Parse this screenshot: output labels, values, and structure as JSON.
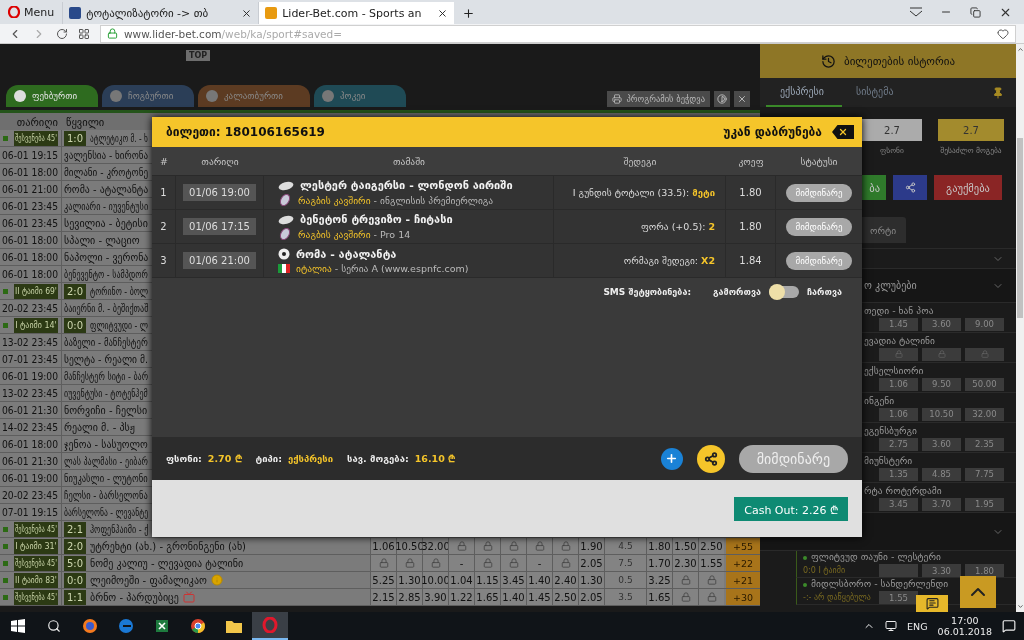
{
  "browser": {
    "menu_label": "Menu",
    "tabs": [
      {
        "title": "ტოტალიზატორი -> თბ",
        "selected": false
      },
      {
        "title": "Lider-Bet.com - Sports an",
        "selected": true
      }
    ],
    "url_host": "www.lider-bet.com",
    "url_path": "/web/ka/sport#saved="
  },
  "top_strip": {
    "badge": "TOP"
  },
  "sport_tabs": [
    {
      "label": "ფეხბურთი",
      "selected": true,
      "color": "#2e6b1f"
    },
    {
      "label": "ჩოგბურთი",
      "selected": false,
      "color": "#2b3e57"
    },
    {
      "label": "კალათბურთი",
      "selected": false,
      "color": "#5c3b22"
    },
    {
      "label": "ჰოკეი",
      "selected": false,
      "color": "#1f4a55"
    }
  ],
  "print_button": "პროგრამის ბეჭდვა",
  "events_table": {
    "columns": [
      "თარიღი",
      "წყვილი"
    ],
    "rows": [
      {
        "kind": "live",
        "status": "შესვენება 45'",
        "score": "1:0",
        "match": "ატლეტიკო მ. - ხ"
      },
      {
        "kind": "scheduled",
        "date": "06-01 19:15",
        "match": "ვალენსია - ხირონა"
      },
      {
        "kind": "scheduled",
        "date": "06-01 18:00",
        "match": "მილანი - კროტონე"
      },
      {
        "kind": "scheduled",
        "date": "06-01 21:00",
        "match": "რომა - ატალანტა"
      },
      {
        "kind": "scheduled",
        "date": "06-01 23:45",
        "match": "კალიარი - იუვენტუსი"
      },
      {
        "kind": "scheduled",
        "date": "06-01 23:45",
        "match": "სევილია - ბეტისი"
      },
      {
        "kind": "scheduled",
        "date": "06-01 18:00",
        "match": "სპალი - ლაციო"
      },
      {
        "kind": "scheduled",
        "date": "06-01 18:00",
        "match": "ნაპოლი - ვერონა"
      },
      {
        "kind": "scheduled",
        "date": "06-01 18:00",
        "match": "ბენევენტო - სამპდორ"
      },
      {
        "kind": "live",
        "status": "II ტაიმი 69'",
        "score": "2:0",
        "match": "ტორინო - ბოლ"
      },
      {
        "kind": "scheduled",
        "date": "20-02 23:45",
        "match": "ბაიერნი მ. - ბეშიქთაშ"
      },
      {
        "kind": "live",
        "status": "I ტაიმი 14'",
        "score": "0:0",
        "match": "ფლიტვუდი - ლ"
      },
      {
        "kind": "scheduled",
        "date": "13-02 23:45",
        "match": "ბაზელი - მანჩესტერ"
      },
      {
        "kind": "scheduled",
        "date": "07-01 23:45",
        "match": "სელტა - რეალი მ."
      },
      {
        "kind": "scheduled",
        "date": "06-01 19:00",
        "match": "მანჩესტერ სიტი - ბარ"
      },
      {
        "kind": "scheduled",
        "date": "13-02 23:45",
        "match": "იუვენტუსი - ტოტენჰემ"
      },
      {
        "kind": "scheduled",
        "date": "06-01 21:30",
        "match": "ნორვიჩი - ჩელსი"
      },
      {
        "kind": "scheduled",
        "date": "14-02 23:45",
        "match": "რეალი მ. - პსჟ"
      },
      {
        "kind": "scheduled",
        "date": "06-01 18:00",
        "match": "ჯენოა - სასუოლო"
      },
      {
        "kind": "scheduled",
        "date": "06-01 21:30",
        "match": "ლას პალმასი - ეიბარ"
      },
      {
        "kind": "scheduled",
        "date": "06-01 19:00",
        "match": "ნიუკასლი - ლუტონი"
      },
      {
        "kind": "scheduled",
        "date": "20-02 23:45",
        "match": "ჩელსი - ბარსელონა"
      },
      {
        "kind": "scheduled",
        "date": "07-01 19:15",
        "match": "ბარსელონა - ლევანტე"
      },
      {
        "kind": "live",
        "status": "შესვენება 45'",
        "score": "2:1",
        "match": "ჰოფენჰაიმი - ქ"
      },
      {
        "kind": "live",
        "status": "I ტაიმი 31'",
        "score": "2:0",
        "match": "უტრეხტი (ახ.) - გრონინგენი (ახ)",
        "more": "+55",
        "odds": [
          {
            "kind": "odd",
            "value": "1.06"
          },
          {
            "kind": "odd",
            "value": "10.50"
          },
          {
            "kind": "odd",
            "value": "32.00"
          },
          {
            "kind": "locked"
          },
          {
            "kind": "locked"
          },
          {
            "kind": "locked"
          },
          {
            "kind": "locked"
          },
          {
            "kind": "locked"
          },
          {
            "kind": "odd",
            "value": "1.90"
          },
          {
            "kind": "line",
            "value": "4.5"
          },
          {
            "kind": "odd",
            "value": "1.80"
          },
          {
            "kind": "odd",
            "value": "1.50"
          },
          {
            "kind": "odd",
            "value": "2.50"
          }
        ]
      },
      {
        "kind": "live",
        "status": "შესვენება 45'",
        "score": "5:0",
        "match": "ნომე კალიუ - ლევადია ტალინი",
        "more": "+22",
        "odds": [
          {
            "kind": "locked"
          },
          {
            "kind": "locked"
          },
          {
            "kind": "locked"
          },
          {
            "kind": "odd",
            "value": "-"
          },
          {
            "kind": "locked"
          },
          {
            "kind": "locked"
          },
          {
            "kind": "odd",
            "value": "-"
          },
          {
            "kind": "locked"
          },
          {
            "kind": "odd",
            "value": "2.05"
          },
          {
            "kind": "line",
            "value": "7.5"
          },
          {
            "kind": "odd",
            "value": "1.70"
          },
          {
            "kind": "odd",
            "value": "2.30"
          },
          {
            "kind": "odd",
            "value": "1.55"
          }
        ]
      },
      {
        "kind": "live",
        "status": "II ტაიმი 83'",
        "score": "0:0",
        "match": "ლეიმოეში - ფამალიკაო",
        "marker": {
          "kind": "info"
        },
        "more": "+21",
        "odds": [
          {
            "kind": "odd",
            "value": "5.25"
          },
          {
            "kind": "odd",
            "value": "1.30"
          },
          {
            "kind": "odd",
            "value": "10.00"
          },
          {
            "kind": "odd",
            "value": "1.04"
          },
          {
            "kind": "odd",
            "value": "1.15"
          },
          {
            "kind": "odd",
            "value": "3.45"
          },
          {
            "kind": "odd",
            "value": "1.40"
          },
          {
            "kind": "odd",
            "value": "2.40"
          },
          {
            "kind": "odd",
            "value": "1.30"
          },
          {
            "kind": "line",
            "value": "0.5"
          },
          {
            "kind": "odd",
            "value": "3.25"
          },
          {
            "kind": "locked"
          },
          {
            "kind": "locked"
          }
        ]
      },
      {
        "kind": "live",
        "status": "შესვენება 45'",
        "score": "1:1",
        "match": "ბრნო - პარდუბიცე",
        "marker": {
          "kind": "tv"
        },
        "more": "+30",
        "odds": [
          {
            "kind": "odd",
            "value": "2.15"
          },
          {
            "kind": "odd",
            "value": "2.85"
          },
          {
            "kind": "odd",
            "value": "3.90"
          },
          {
            "kind": "odd",
            "value": "1.22"
          },
          {
            "kind": "odd",
            "value": "1.65"
          },
          {
            "kind": "odd",
            "value": "1.40"
          },
          {
            "kind": "odd",
            "value": "1.45"
          },
          {
            "kind": "odd",
            "value": "2.50"
          },
          {
            "kind": "odd",
            "value": "2.05"
          },
          {
            "kind": "line",
            "value": "3.5"
          },
          {
            "kind": "odd",
            "value": "1.65"
          },
          {
            "kind": "locked"
          },
          {
            "kind": "locked"
          }
        ]
      }
    ]
  },
  "bet_panel": {
    "history_button": "ბილეთების ისტორია",
    "tabs": [
      {
        "label": "ექსპრესი",
        "selected": true
      },
      {
        "label": "სისტემა",
        "selected": false
      }
    ],
    "stake_boxes": [
      {
        "kind": "stake",
        "value": "2.7",
        "label": "ფსონი"
      },
      {
        "kind": "win",
        "value": "2.7",
        "label": "შესაძლო მოგება"
      }
    ],
    "place_button": "ბა",
    "cancel_button": "გაუქმება",
    "sub_tab": "ორტი",
    "section_title": "ო კლუბები",
    "matches": [
      {
        "name": "თედი - ხან პოა",
        "odds": [
          {
            "kind": "odd",
            "value": "1.45"
          },
          {
            "kind": "odd",
            "value": "3.60"
          },
          {
            "kind": "odd",
            "value": "9.00"
          }
        ]
      },
      {
        "name": "ევადია ტალინი",
        "odds": [
          {
            "kind": "locked"
          },
          {
            "kind": "locked"
          },
          {
            "kind": "locked"
          }
        ]
      },
      {
        "name": "ექსელსიორი",
        "odds": [
          {
            "kind": "odd",
            "value": "1.06"
          },
          {
            "kind": "odd",
            "value": "9.50"
          },
          {
            "kind": "odd",
            "value": "50.00"
          }
        ]
      },
      {
        "name": "ინგენი",
        "odds": [
          {
            "kind": "odd",
            "value": "1.06"
          },
          {
            "kind": "odd",
            "value": "10.50"
          },
          {
            "kind": "odd",
            "value": "32.00"
          }
        ]
      },
      {
        "name": "ეგენსბურგი",
        "odds": [
          {
            "kind": "odd",
            "value": "2.75"
          },
          {
            "kind": "odd",
            "value": "3.60"
          },
          {
            "kind": "odd",
            "value": "2.35"
          }
        ]
      },
      {
        "name": "მიუნსტერი",
        "odds": [
          {
            "kind": "odd",
            "value": "1.35"
          },
          {
            "kind": "odd",
            "value": "4.85"
          },
          {
            "kind": "odd",
            "value": "7.75"
          }
        ]
      },
      {
        "name": "რტა როტერდამი",
        "odds": [
          {
            "kind": "odd",
            "value": "3.45"
          },
          {
            "kind": "odd",
            "value": "3.70"
          },
          {
            "kind": "odd",
            "value": "1.95"
          }
        ]
      }
    ],
    "live_matches": [
      {
        "name": "ფლიტვუდ თაუნი - ლესტერი",
        "score": "0:0",
        "status": "I ტაიმი",
        "odds": [
          {
            "kind": "blank"
          },
          {
            "kind": "odd",
            "value": "3.30"
          },
          {
            "kind": "odd",
            "value": "1.80"
          }
        ]
      },
      {
        "name": "მიდლსბორო - სანდერლენდი",
        "score": "-:-",
        "status": "არ დაწყებულა",
        "odds": [
          {
            "kind": "odd",
            "value": "1.55"
          }
        ]
      }
    ]
  },
  "ticket_modal": {
    "title": "ბილეთი: 180106165619",
    "back_label": "უკან დაბრუნება",
    "columns": [
      "#",
      "თარიღი",
      "თამაში",
      "შედეგი",
      "კოეფ",
      "სტატუსი"
    ],
    "rows": [
      {
        "number": "1",
        "date": "01/06 19:00",
        "game": "ლესტერ ტაიგერსი - ლონდონ აირიში",
        "sport_icon": {
          "kind": "rugby"
        },
        "region_icon": {
          "kind": "rugby"
        },
        "category": "რაგბის კავშირი",
        "league": "- ინგლისის პრემიერლიგა",
        "market": "I გუნდის ტოტალი (33.5):",
        "pick": "მეტი",
        "odd": "1.80",
        "status": "მიმდინარე"
      },
      {
        "number": "2",
        "date": "01/06 17:15",
        "game": "ბენეტონ ტრევიზო - ჩიტასი",
        "sport_icon": {
          "kind": "rugby"
        },
        "region_icon": {
          "kind": "rugby"
        },
        "category": "რაგბის კავშირი",
        "league": "- Pro 14",
        "market": "ფორა (+0.5):",
        "pick": "2",
        "odd": "1.80",
        "status": "მიმდინარე"
      },
      {
        "number": "3",
        "date": "01/06 21:00",
        "game": "რომა - ატალანტა",
        "sport_icon": {
          "kind": "soccer"
        },
        "region_icon": {
          "kind": "italy"
        },
        "category": "იტალია",
        "league": "- სერია A (www.espnfc.com)",
        "market": "ორმაგი შედეგი:",
        "pick": "X2",
        "odd": "1.84",
        "status": "მიმდინარე"
      }
    ],
    "sms": {
      "label": "SMS შეტყობინება:",
      "off_label": "გამორთვა",
      "on_label": "ჩართვა",
      "on": false
    },
    "summary": [
      {
        "label": "ფსონი:",
        "value": "2.70 ₾"
      },
      {
        "label": "ტიპი:",
        "value": "ექსპრესი"
      },
      {
        "label": "სავ. მოგება:",
        "value": "16.10 ₾"
      }
    ],
    "state_button": "მიმდინარე",
    "cashout_button": "Cash Out: 2.26 ₾"
  },
  "taskbar": {
    "language": "ENG",
    "time": "17:00",
    "date": "06.01.2018"
  }
}
